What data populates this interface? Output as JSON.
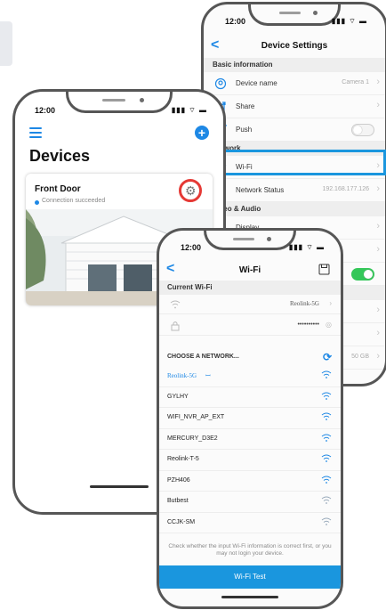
{
  "settings": {
    "time": "12:00",
    "title": "Device Settings",
    "sections": {
      "basic": "Basic information",
      "network": "Network",
      "video": "Video & Audio"
    },
    "rows": {
      "device_name": {
        "label": "Device name",
        "value": "Camera 1"
      },
      "share": {
        "label": "Share"
      },
      "push": {
        "label": "Push",
        "on": false
      },
      "wifi": {
        "label": "Wi-Fi"
      },
      "network_status": {
        "label": "Network Status",
        "value": "192.168.177.126"
      },
      "display": {
        "label": "Display"
      }
    },
    "partial_value": "50 GB"
  },
  "devices": {
    "time": "12:00",
    "title": "Devices",
    "card": {
      "name": "Front Door",
      "status": "Connection succeeded"
    }
  },
  "wifi": {
    "time": "12:00",
    "title": "Wi-Fi",
    "current_header": "Current Wi-Fi",
    "current_ssid": "Reolink-5G",
    "password_mask": "••••••••••",
    "choose_header": "CHOOSE A NETWORK...",
    "networks": [
      {
        "name": "Reolink-5G",
        "selected": true
      },
      {
        "name": "GYLHY"
      },
      {
        "name": "WIFI_NVR_AP_EXT"
      },
      {
        "name": "MERCURY_D3E2"
      },
      {
        "name": "Reolink-T-5"
      },
      {
        "name": "PZH406"
      },
      {
        "name": "Butbest"
      },
      {
        "name": "CCJK-SM"
      }
    ],
    "note": "Check whether the input Wi-Fi information is correct first, or you may not login your device.",
    "test_button": "Wi-Fi Test"
  },
  "colors": {
    "accent": "#1e88e5",
    "highlight": "#1a96de",
    "gear_ring": "#e53935",
    "toggle_on": "#34c759"
  }
}
